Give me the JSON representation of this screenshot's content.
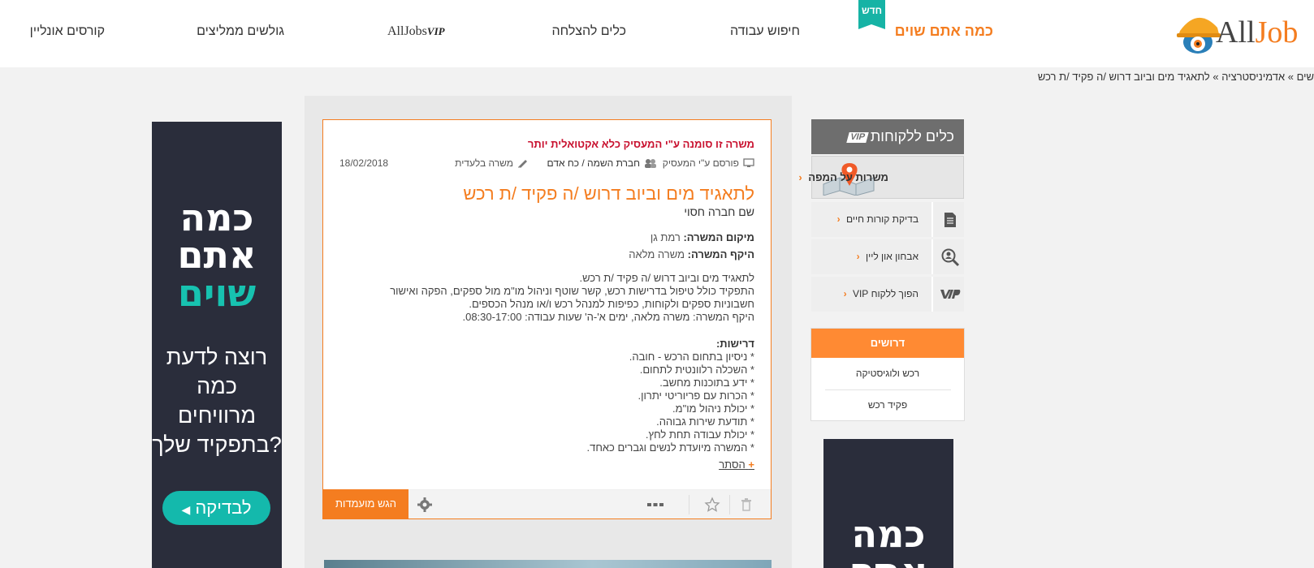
{
  "nav": {
    "logo_all": "All",
    "logo_job": "Job",
    "how_much": "כמה אתם שוים",
    "new_badge": "חדש",
    "job_search": "חיפוש עבודה",
    "success_tools": "כלים להצלחה",
    "alljobs_vip_text": "AllJobs",
    "alljobs_vip_tag": "VIP",
    "recommended": "גולשים ממליצים",
    "courses": "קורסים אונליין"
  },
  "breadcrumb": "שים » אדמיניסטרציה » לתאגיד מים וביוב דרוש /ה פקיד /ת רכש",
  "ad_left": {
    "line1": "כמה",
    "line2": "אתם",
    "line3": "שוים",
    "q1": "רוצה לדעת",
    "q2": "כמה",
    "q3": "מרוויחים",
    "q4": "בתפקיד שלך?",
    "button": "לבדיקה"
  },
  "ad_right": {
    "line1": "כמה",
    "line2": "אתם"
  },
  "job": {
    "marked_notice": "משרה זו סומנה ע\"י המעסיק כלא אקטואלית יותר",
    "posted_by": "פורסם ע\"י המעסיק",
    "company_type": "חברת השמה / כח אדם",
    "exclusive": "משרה בלעדית",
    "date": "18/02/2018",
    "title": "לתאגיד מים וביוב דרוש /ה פקיד /ת רכש",
    "company": "שם חברה חסוי",
    "location_label": "מיקום המשרה:",
    "location_value": "רמת גן",
    "scope_label": "היקף המשרה:",
    "scope_value": "משרה מלאה",
    "desc1": "לתאגיד מים וביוב דרוש /ה פקיד /ת רכש.",
    "desc2": "התפקיד כולל טיפול בדרישות רכש, קשר שוטף וניהול מו\"מ מול ספקים, הפקה ואישור חשבוניות ספקים ולקוחות, כפיפות למנהל רכש ו/או מנהל הכספים.",
    "desc3": "היקף המשרה: משרה מלאה, ימים א'-ה' שעות עבודה: 08:30-17:00.",
    "reqs_title": "דרישות:",
    "reqs": [
      "* ניסיון בתחום הרכש - חובה.",
      "* השכלה רלוונטית לתחום.",
      "* ידע בתוכנות מחשב.",
      "* הכרות עם פריוריטי יתרון.",
      "* יכולת ניהול מו\"מ.",
      "* תודעת שירות גבוהה.",
      "* יכולת עבודה תחת לחץ.",
      "* המשרה מיועדת לנשים וגברים כאחד."
    ],
    "hide": "הסתר",
    "hide_plus": "+",
    "apply": "הגש מועמדות"
  },
  "sidebar": {
    "tools_title": "כלים ללקוחות",
    "tools_vip": "VIP",
    "map_jobs": "משרות על המפה",
    "cv_check": "בדיקת קורות חיים",
    "online_test": "אבחון און ליין",
    "become_vip": "הפוך ללקוח VIP",
    "wanted_title": "דרושים",
    "wanted_items": [
      "רכש ולוגיסטיקה",
      "פקיד רכש"
    ]
  },
  "colors": {
    "accent": "#f47d20",
    "teal": "#16b3a5",
    "ad_bg": "#2a2d3b",
    "alert": "#c8102e"
  }
}
